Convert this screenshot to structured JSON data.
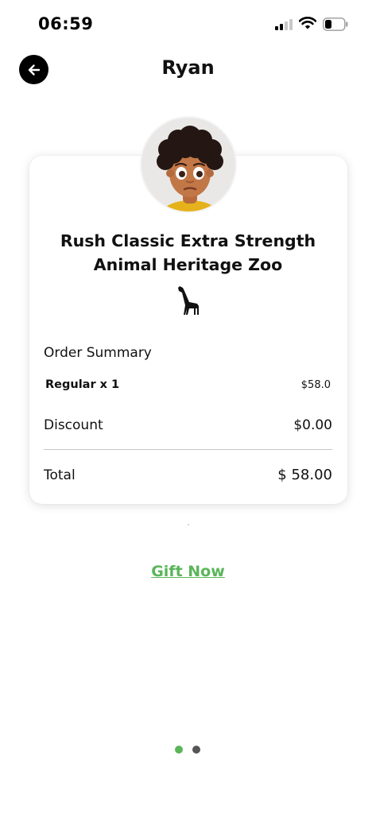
{
  "status_bar": {
    "time": "06:59",
    "battery_level": 0.35
  },
  "header": {
    "title": "Ryan",
    "back_icon": "arrow-left-icon"
  },
  "card": {
    "product_name": "Rush Classic Extra Strength Animal Heritage Zoo",
    "brand_icon": "giraffe-icon",
    "summary_label": "Order Summary",
    "regular_label": "Regular x 1",
    "regular_price": "$58.0",
    "discount_label": "Discount",
    "discount_value": "$0.00",
    "total_label": "Total",
    "total_value": "$ 58.00"
  },
  "gift_now_label": "Gift Now",
  "pager": {
    "pages": 2,
    "active_index": 0
  },
  "colors": {
    "accent": "#5bb55a",
    "pager_inactive": "#555555",
    "back_button": "#000000"
  }
}
